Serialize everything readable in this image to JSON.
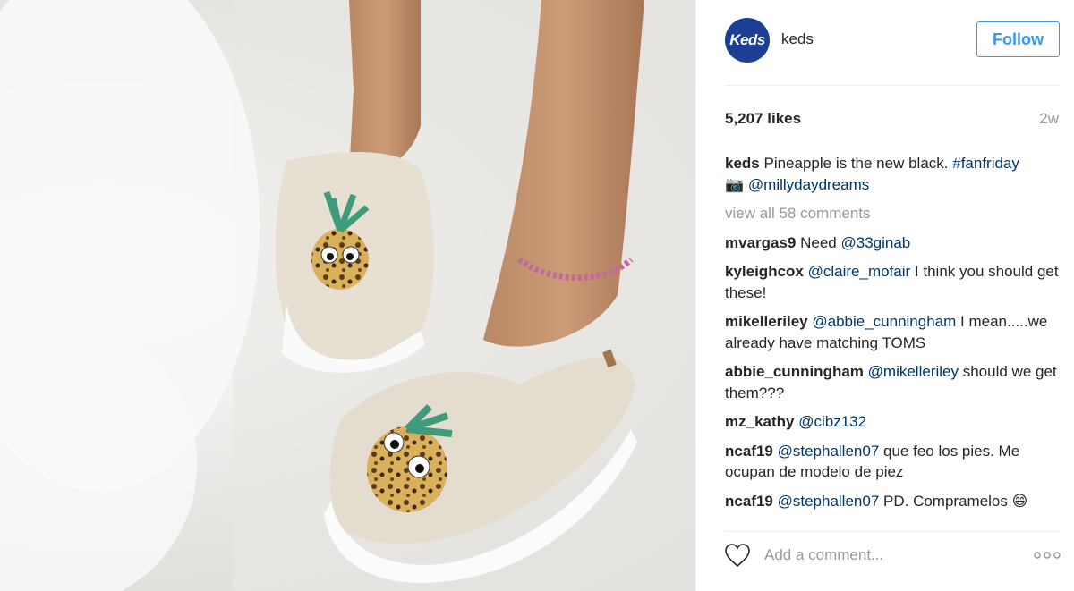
{
  "account": {
    "avatar_text": "Keds",
    "username": "keds",
    "follow_label": "Follow"
  },
  "post": {
    "likes": "5,207 likes",
    "time": "2w",
    "caption": {
      "author": "keds",
      "text": "Pineapple is the new black.",
      "hashtag": "#fanfriday",
      "camera_emoji": "📷",
      "mention": "@millydaydreams"
    },
    "view_all": "view all 58 comments",
    "comments": [
      {
        "author": "mvargas9",
        "pre": "Need",
        "mention": "@33ginab",
        "post": ""
      },
      {
        "author": "kyleighcox",
        "pre": "",
        "mention": "@claire_mofair",
        "post": "I think you should get these!"
      },
      {
        "author": "mikelleriley",
        "pre": "",
        "mention": "@abbie_cunningham",
        "post": "I mean.....we already have matching TOMS"
      },
      {
        "author": "abbie_cunningham",
        "pre": "",
        "mention": "@mikelleriley",
        "post": "should we get them???"
      },
      {
        "author": "mz_kathy",
        "pre": "",
        "mention": "@cibz132",
        "post": ""
      },
      {
        "author": "ncaf19",
        "pre": "",
        "mention": "@stephallen07",
        "post": "que feo los pies. Me ocupan de modelo de piez"
      },
      {
        "author": "ncaf19",
        "pre": "",
        "mention": "@stephallen07",
        "post": "PD. Compramelos 😄"
      }
    ],
    "add_comment_placeholder": "Add a comment...",
    "more_options_label": "ooo"
  },
  "icons": {
    "heart": "heart-icon",
    "more": "more-options-icon"
  },
  "colors": {
    "link": "#003569",
    "follow": "#3897f0",
    "avatar_bg": "#1c3f94",
    "muted": "#999999"
  }
}
